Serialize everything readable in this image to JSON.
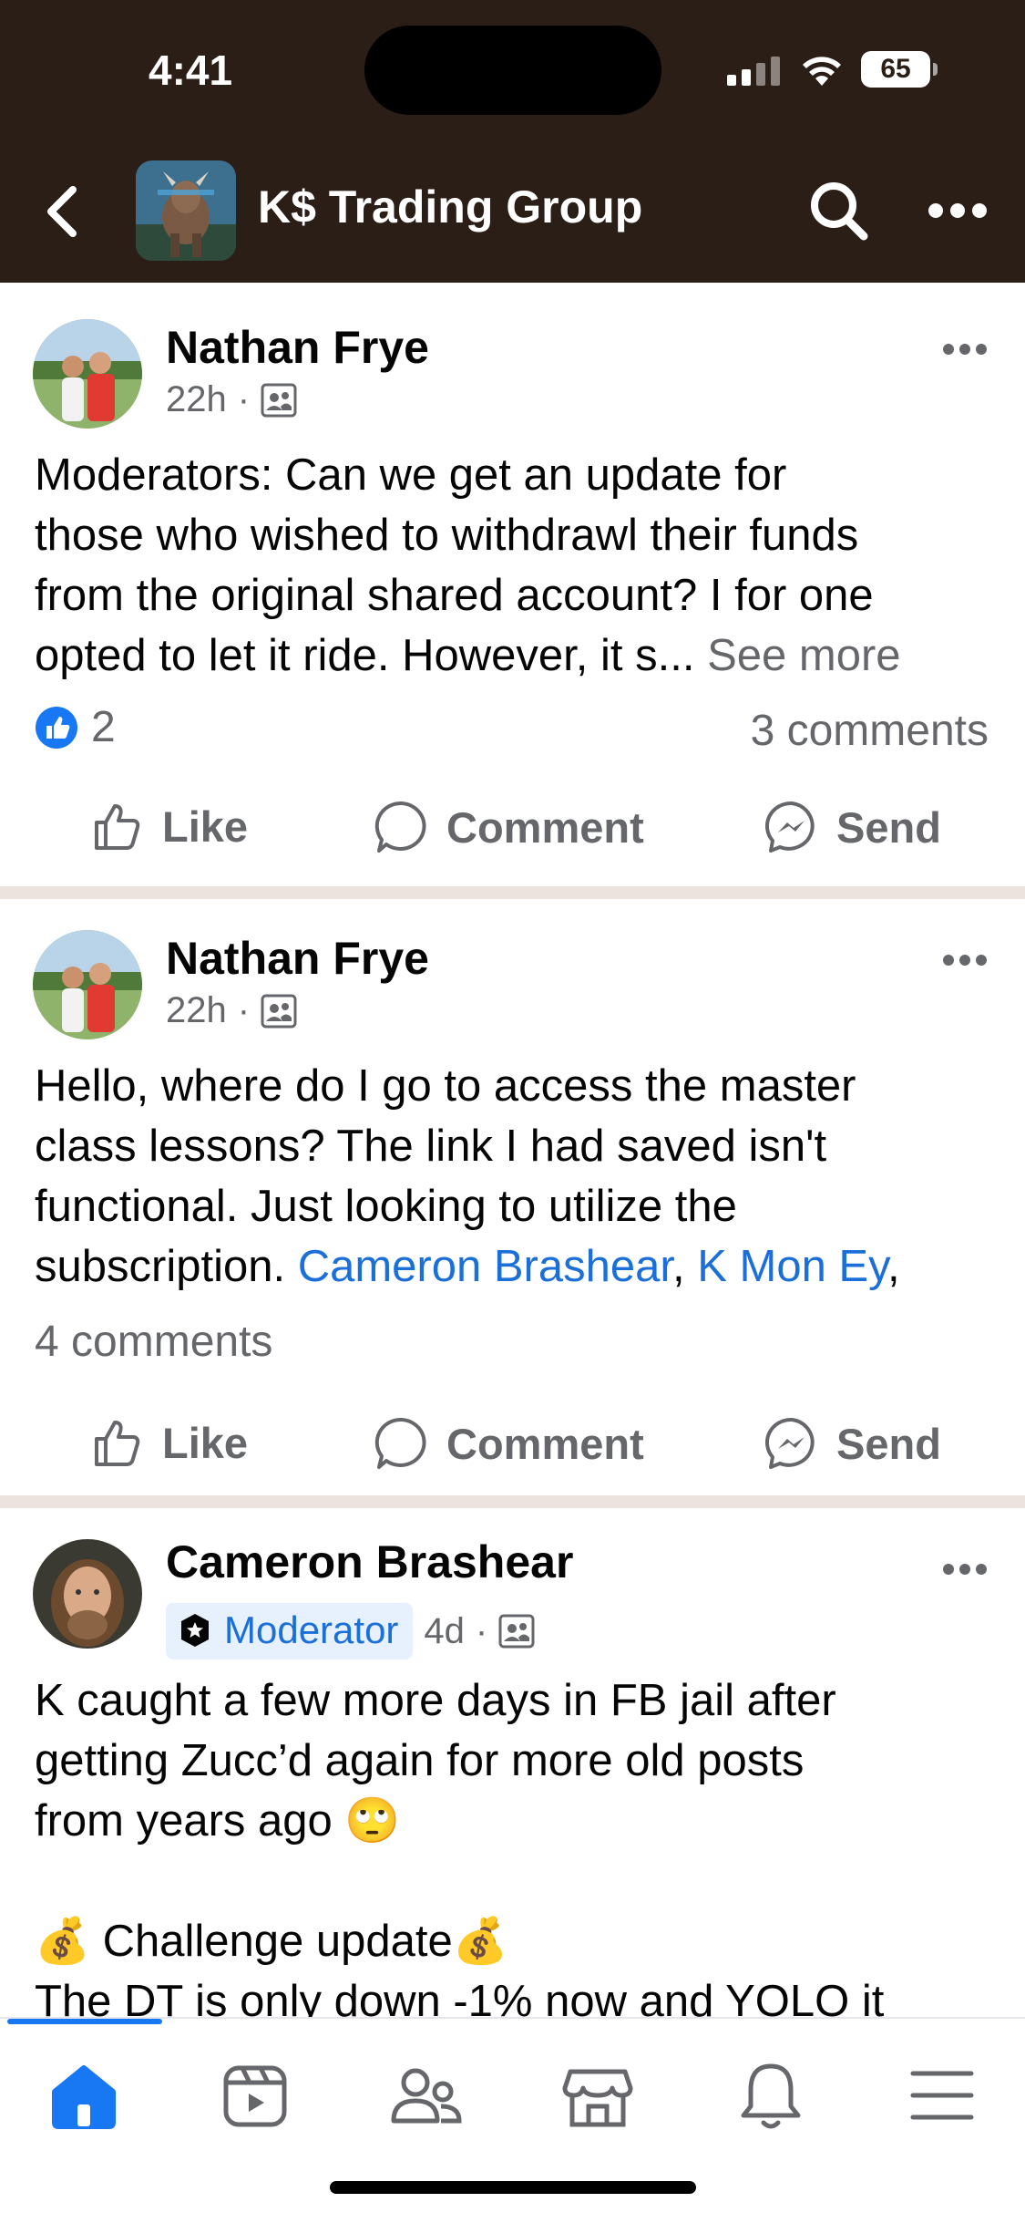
{
  "status_bar": {
    "time": "4:41",
    "battery": "65"
  },
  "header": {
    "title": "K$ Trading Group"
  },
  "posts": [
    {
      "author": "Nathan Frye",
      "time": "22h",
      "separator": "·",
      "text": "Moderators: Can we get an update for\nthose who wished to withdrawl their funds\nfrom the original shared account? I for one\nopted to let it ride. However, it s...",
      "see_more": "See more",
      "reaction_count": "2",
      "comments": "3 comments"
    },
    {
      "author": "Nathan Frye",
      "time": "22h",
      "separator": "·",
      "text": "Hello, where do I go to access the master\nclass lessons? The link I had saved isn't\nfunctional. Just looking to utilize the\nsubscription. ",
      "tags": [
        "Cameron Brashear",
        "K Mon Ey"
      ],
      "tag_sep": ", ",
      "tag_end": ",",
      "comments": "4 comments"
    },
    {
      "author": "Cameron Brashear",
      "badge": "Moderator",
      "time": "4d",
      "separator": "·",
      "text": "K caught a few more days in FB jail after\ngetting Zucc’d again for more old posts\nfrom years ago 🙄\n\n💰 Challenge update💰\nThe DT is only down -1% now and YOLO it"
    }
  ],
  "actions": {
    "like": "Like",
    "comment": "Comment",
    "send": "Send"
  },
  "nav": {
    "items": [
      "home-icon",
      "video-icon",
      "groups-icon",
      "marketplace-icon",
      "notifications-icon",
      "menu-icon"
    ],
    "active": "home-icon",
    "active_color": "#1877f2",
    "inactive_color": "#65676b"
  }
}
